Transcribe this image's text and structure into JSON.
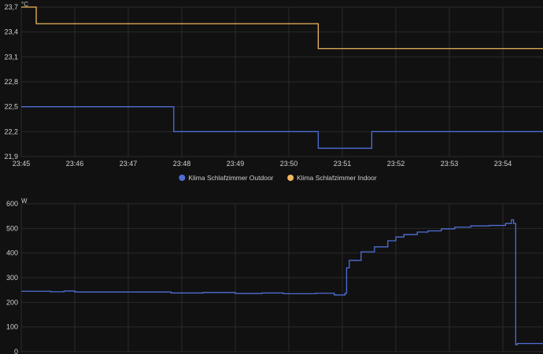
{
  "colors": {
    "background": "#111111",
    "grid": "#2a2a2a",
    "axis_text": "#d0d0d0",
    "outdoor": "#4f6fd6",
    "indoor": "#f0b75f",
    "power": "#4f6fd6"
  },
  "chart_data": [
    {
      "type": "line",
      "step": true,
      "unit_label": "°C",
      "x_tick_labels": [
        "23:45",
        "23:46",
        "23:47",
        "23:48",
        "23:49",
        "23:50",
        "23:51",
        "23:52",
        "23:53",
        "23:54"
      ],
      "xlim_minutes": [
        0,
        9.75
      ],
      "ylim": [
        21.9,
        23.7
      ],
      "y_ticks": [
        21.9,
        22.2,
        22.5,
        22.8,
        23.1,
        23.4,
        23.7
      ],
      "y_tick_labels": [
        "21,9",
        "22,2",
        "22,5",
        "22,8",
        "23,1",
        "23,4",
        "23,7"
      ],
      "grid": true,
      "legend": {
        "placement": "bottom-center",
        "items": [
          "Klima Schlafzimmer Outdoor",
          "Klima Schlafzimmer Indoor"
        ]
      },
      "series": [
        {
          "name": "Klima Schlafzimmer Outdoor",
          "color": "#4f6fd6",
          "x_minutes": [
            0,
            2.85,
            5.55,
            6.55,
            9.75
          ],
          "y": [
            22.5,
            22.2,
            22.0,
            22.2,
            22.2
          ]
        },
        {
          "name": "Klima Schlafzimmer Indoor",
          "color": "#f0b75f",
          "x_minutes": [
            0,
            0.28,
            5.55,
            9.75
          ],
          "y": [
            23.7,
            23.5,
            23.2,
            23.2
          ]
        }
      ]
    },
    {
      "type": "line",
      "step": true,
      "unit_label": "W",
      "x_tick_labels": [],
      "xlim_minutes": [
        0,
        9.75
      ],
      "ylim": [
        0,
        600
      ],
      "y_ticks": [
        0,
        100,
        200,
        300,
        400,
        500,
        600
      ],
      "y_tick_labels": [
        "0",
        "100",
        "200",
        "300",
        "400",
        "500",
        "600"
      ],
      "grid": true,
      "series": [
        {
          "color": "#4f6fd6",
          "x_minutes": [
            0,
            0.55,
            0.8,
            1.0,
            2.8,
            3.4,
            4.0,
            4.5,
            4.9,
            5.5,
            5.85,
            6.05,
            6.08,
            6.13,
            6.35,
            6.55,
            6.6,
            6.7,
            6.85,
            7.0,
            7.15,
            7.4,
            7.6,
            7.85,
            8.1,
            8.4,
            8.75,
            9.05,
            9.12,
            9.16,
            9.2,
            9.24,
            9.27,
            9.75
          ],
          "y": [
            245,
            243,
            246,
            242,
            238,
            240,
            236,
            238,
            235,
            237,
            230,
            237,
            340,
            370,
            405,
            405,
            425,
            425,
            450,
            465,
            475,
            485,
            490,
            498,
            505,
            510,
            512,
            520,
            520,
            535,
            520,
            28,
            33,
            30
          ]
        }
      ]
    }
  ]
}
